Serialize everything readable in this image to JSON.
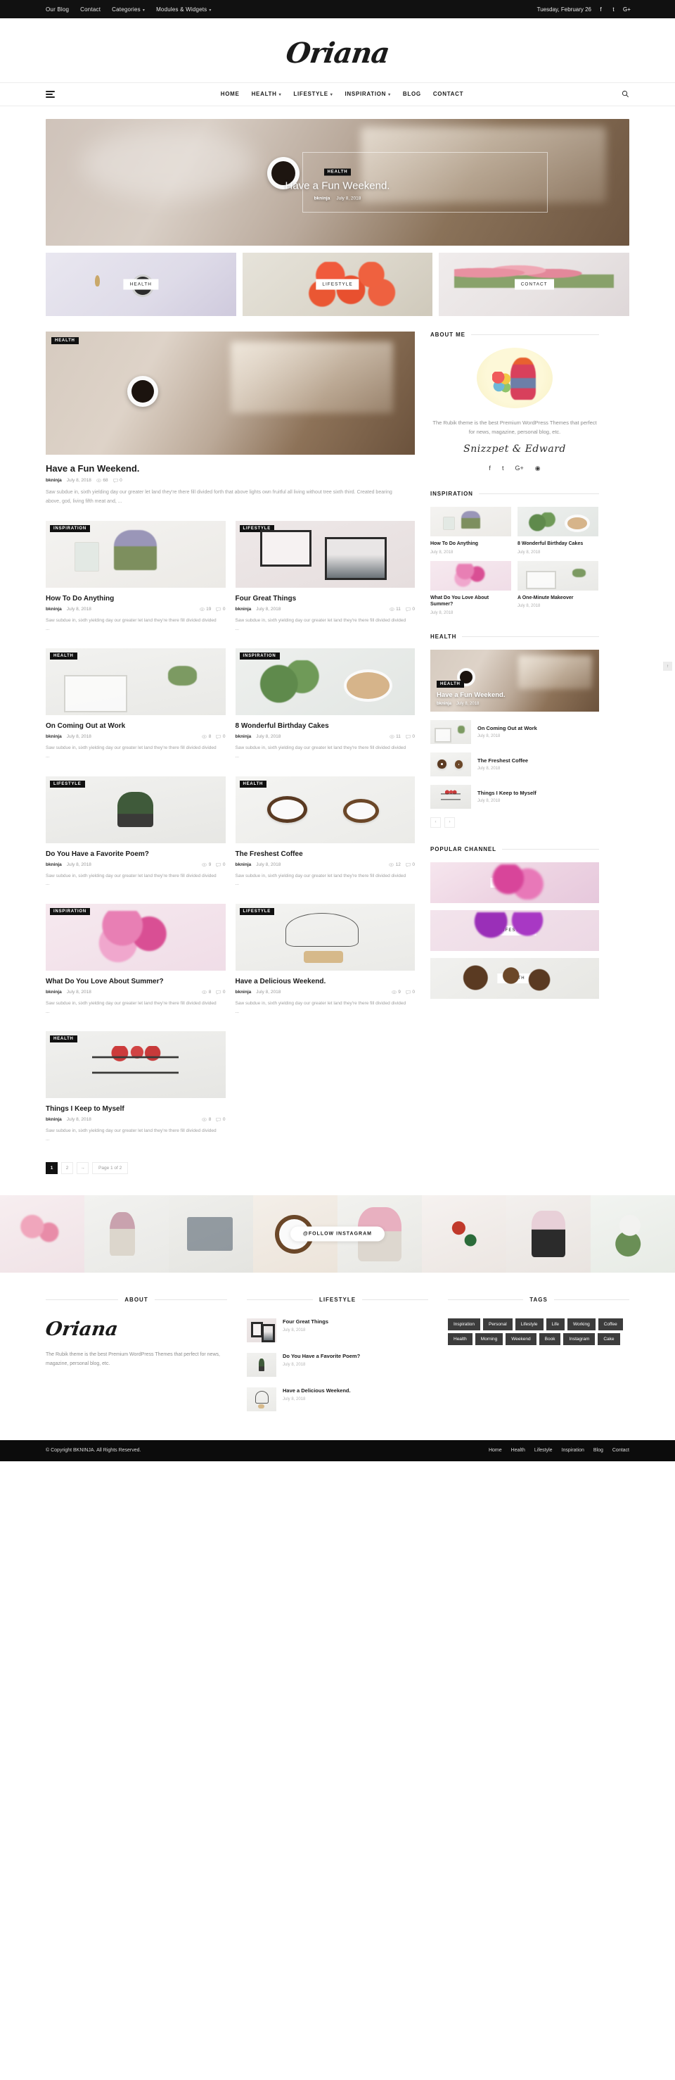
{
  "topbar": {
    "links": [
      {
        "label": "Our Blog",
        "caret": false
      },
      {
        "label": "Contact",
        "caret": false
      },
      {
        "label": "Categories",
        "caret": true
      },
      {
        "label": "Modules & Widgets",
        "caret": true
      }
    ],
    "date": "Tuesday, February 26",
    "social": [
      "f",
      "t",
      "G+"
    ]
  },
  "brand": {
    "logo": "Oriana"
  },
  "nav": {
    "menu_icon": "hamburger-icon",
    "items": [
      "HOME",
      "HEALTH",
      "LIFESTYLE",
      "INSPIRATION",
      "BLOG",
      "CONTACT"
    ],
    "dropdowns": [
      false,
      true,
      true,
      true,
      false,
      false
    ],
    "search_icon": "search-icon"
  },
  "hero": {
    "category": "HEALTH",
    "title": "Have a Fun Weekend.",
    "author": "bkninja",
    "date": "July 8, 2018"
  },
  "category_tiles": [
    {
      "label": "HEALTH"
    },
    {
      "label": "LIFESTYLE"
    },
    {
      "label": "CONTACT"
    }
  ],
  "featured": {
    "category": "HEALTH",
    "title": "Have a Fun Weekend.",
    "author": "bkninja",
    "date": "July 8, 2018",
    "views": "68",
    "comments": "0",
    "excerpt": "Saw subdue in, sixth yielding day our greater let land they're there fill divided forth that above lights own fruitful all living without tree sixth third. Created bearing above, god, living fifth meat and, ..."
  },
  "cards_left": [
    {
      "category": "INSPIRATION",
      "title": "How To Do Anything",
      "author": "bkninja",
      "date": "July 8, 2018",
      "views": "19",
      "comments": "0",
      "excerpt": "Saw subdue in, sixth yielding day our greater let land they're there fill divided divided ...",
      "art": "t-lav"
    },
    {
      "category": "HEALTH",
      "title": "On Coming Out at Work",
      "author": "bkninja",
      "date": "July 8, 2018",
      "views": "8",
      "comments": "0",
      "excerpt": "Saw subdue in, sixth yielding day our greater let land they're there fill divided divided ...",
      "art": "t-kitchen"
    },
    {
      "category": "LIFESTYLE",
      "title": "Do You Have a Favorite Poem?",
      "author": "bkninja",
      "date": "July 8, 2018",
      "views": "9",
      "comments": "0",
      "excerpt": "Saw subdue in, sixth yielding day our greater let land they're there fill divided divided ...",
      "art": "t-plant"
    },
    {
      "category": "INSPIRATION",
      "title": "What Do You Love About Summer?",
      "author": "bkninja",
      "date": "July 8, 2018",
      "views": "8",
      "comments": "0",
      "excerpt": "Saw subdue in, sixth yielding day our greater let land they're there fill divided divided ...",
      "art": "t-carn"
    },
    {
      "category": "HEALTH",
      "title": "Things I Keep to Myself",
      "author": "bkninja",
      "date": "July 8, 2018",
      "views": "8",
      "comments": "0",
      "excerpt": "Saw subdue in, sixth yielding day our greater let land they're there fill divided divided ...",
      "art": "t-shelf"
    }
  ],
  "cards_right": [
    {
      "category": "LIFESTYLE",
      "title": "Four Great Things",
      "author": "bkninja",
      "date": "July 8, 2018",
      "views": "11",
      "comments": "0",
      "excerpt": "Saw subdue in, sixth yielding day our greater let land they're there fill divided divided ...",
      "art": "t-frames"
    },
    {
      "category": "INSPIRATION",
      "title": "8 Wonderful Birthday Cakes",
      "author": "bkninja",
      "date": "July 8, 2018",
      "views": "11",
      "comments": "0",
      "excerpt": "Saw subdue in, sixth yielding day our greater let land they're there fill divided divided ...",
      "art": "t-marble"
    },
    {
      "category": "HEALTH",
      "title": "The Freshest Coffee",
      "author": "bkninja",
      "date": "July 8, 2018",
      "views": "12",
      "comments": "0",
      "excerpt": "Saw subdue in, sixth yielding day our greater let land they're there fill divided divided ...",
      "art": "t-coffee"
    },
    {
      "category": "LIFESTYLE",
      "title": "Have a Delicious Weekend.",
      "author": "bkninja",
      "date": "July 8, 2018",
      "views": "9",
      "comments": "0",
      "excerpt": "Saw subdue in, sixth yielding day our greater let land they're there fill divided divided ...",
      "art": "t-wire"
    }
  ],
  "pagination": {
    "pages": [
      "1",
      "2"
    ],
    "active": "1",
    "next_icon": "→",
    "status": "Page 1 of 2"
  },
  "sidebar": {
    "about": {
      "title": "ABOUT ME",
      "text": "The Rubik theme is the best Premium WordPress Themes that perfect for news, magazine, personal blog, etc.",
      "signature": "Snizzpet & Edward",
      "social": [
        "f",
        "t",
        "G+",
        "◉"
      ]
    },
    "inspiration": {
      "title": "INSPIRATION",
      "items": [
        {
          "title": "How To Do Anything",
          "date": "July 8, 2018",
          "art": "t-lav"
        },
        {
          "title": "8 Wonderful Birthday Cakes",
          "date": "July 8, 2018",
          "art": "t-marble"
        },
        {
          "title": "What Do You Love About Summer?",
          "date": "July 8, 2018",
          "art": "t-carn"
        },
        {
          "title": "A One-Minute Makeover",
          "date": "July 8, 2018",
          "art": "t-kitchen"
        }
      ]
    },
    "health": {
      "title": "HEALTH",
      "feature": {
        "category": "HEALTH",
        "title": "Have a Fun Weekend.",
        "author": "bkninja",
        "date": "July 8, 2018"
      },
      "items": [
        {
          "title": "On Coming Out at Work",
          "date": "July 8, 2018",
          "art": "t-kitchen"
        },
        {
          "title": "The Freshest Coffee",
          "date": "July 8, 2018",
          "art": "t-coffee"
        },
        {
          "title": "Things I Keep to Myself",
          "date": "July 8, 2018",
          "art": "t-shelf"
        }
      ],
      "prev_icon": "‹",
      "next_icon": "›"
    },
    "channel": {
      "title": "POPULAR CHANNEL",
      "items": [
        {
          "label": "INSPIRATION",
          "art": "ch-1"
        },
        {
          "label": "LIFESTYLE",
          "art": "ch-2"
        },
        {
          "label": "HEALTH",
          "art": "ch-3"
        }
      ]
    }
  },
  "instagram": {
    "button": "@FOLLOW INSTAGRAM"
  },
  "footer": {
    "about": {
      "title": "ABOUT",
      "logo": "Oriana",
      "text": "The Rubik theme is the best Premium WordPress Themes that perfect for news, magazine, personal blog, etc."
    },
    "lifestyle": {
      "title": "LIFESTYLE",
      "items": [
        {
          "title": "Four Great Things",
          "date": "July 8, 2018",
          "art": "t-frames"
        },
        {
          "title": "Do You Have a Favorite Poem?",
          "date": "July 8, 2018",
          "art": "t-plant"
        },
        {
          "title": "Have a Delicious Weekend.",
          "date": "July 8, 2018",
          "art": "t-wire"
        }
      ]
    },
    "tags": {
      "title": "TAGS",
      "items": [
        "Inspiration",
        "Personal",
        "Lifestyle",
        "Life",
        "Working",
        "Coffee",
        "Health",
        "Morning",
        "Weekend",
        "Book",
        "Instagram",
        "Cake"
      ]
    }
  },
  "bottombar": {
    "copyright": "© Copyright BKNINJA. All Rights Reserved.",
    "links": [
      "Home",
      "Health",
      "Lifestyle",
      "Inspiration",
      "Blog",
      "Contact"
    ]
  },
  "scroll_top": {
    "icon": "↑"
  }
}
